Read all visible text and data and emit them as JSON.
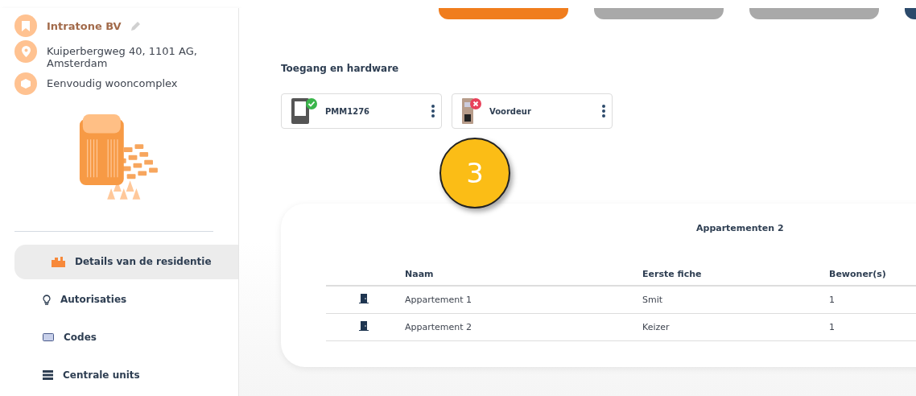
{
  "sidebar": {
    "info": [
      {
        "kind": "name",
        "text": "Intratone BV"
      },
      {
        "kind": "address",
        "text": "Kuiperbergweg 40, 1101 AG, Amsterdam"
      },
      {
        "kind": "type",
        "text": "Eenvoudig wooncomplex"
      }
    ],
    "menu": [
      {
        "label": "Details van de residentie",
        "kind": "buildings",
        "selected": true
      },
      {
        "label": "Autorisaties",
        "kind": "bulb",
        "selected": false
      },
      {
        "label": "Codes",
        "kind": "keyboard",
        "selected": false
      },
      {
        "label": "Centrale units",
        "kind": "server",
        "selected": false
      }
    ]
  },
  "top_buttons": [
    {
      "color": "#f07d1e"
    },
    {
      "color": "#a9a9a9"
    },
    {
      "color": "#a9a9a9"
    },
    {
      "color": "#2c4a6b"
    }
  ],
  "hardware": {
    "title": "Toegang en hardware",
    "devices": [
      {
        "name": "PMM1276",
        "kind": "panel",
        "connected": true
      },
      {
        "name": "Voordeur",
        "kind": "keypad",
        "connected": false
      }
    ]
  },
  "step_badge": "3",
  "apartments": {
    "title": "Appartementen 2",
    "columns": [
      "Naam",
      "Eerste fiche",
      "Bewoner(s)"
    ],
    "rows": [
      [
        "Appartement 1",
        "Smit",
        "1"
      ],
      [
        "Appartement 2",
        "Keizer",
        "1"
      ]
    ]
  }
}
